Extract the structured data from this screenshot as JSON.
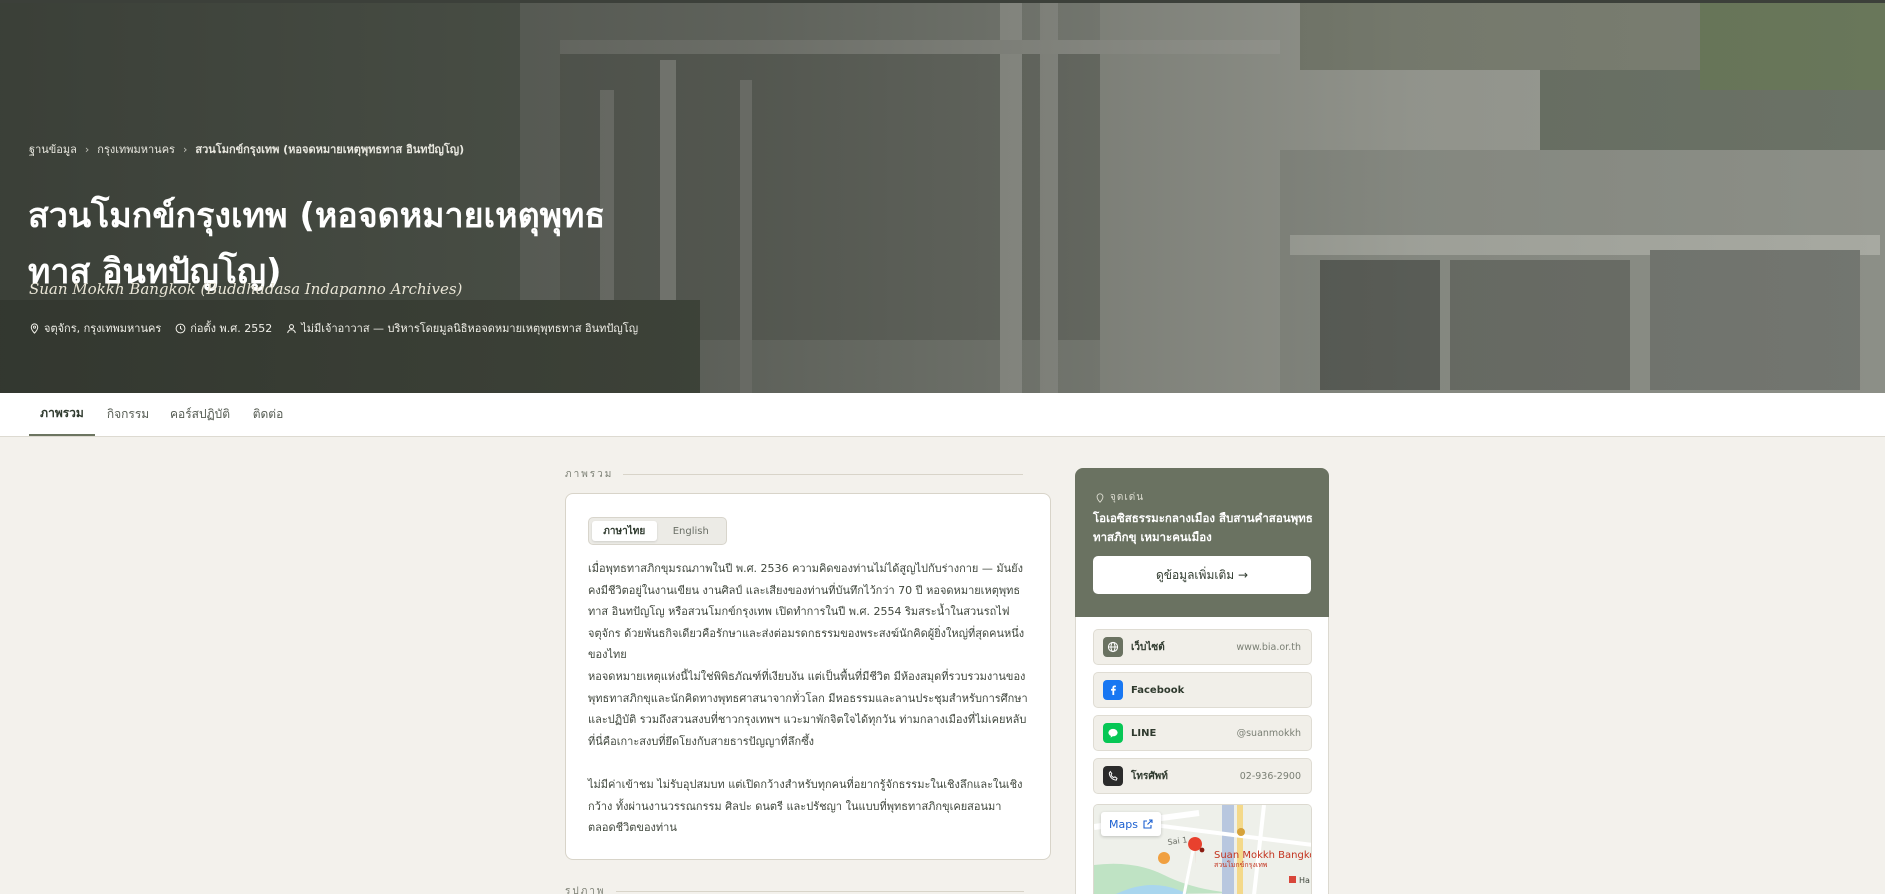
{
  "hero": {
    "breadcrumb": [
      "ฐานข้อมูล",
      "กรุงเทพมหานคร",
      "สวนโมกข์กรุงเทพ (หอจดหมายเหตุพุทธทาส อินทปัญโญ)"
    ],
    "breadcrumb_sep": "›",
    "title_line1": "สวนโมกข์กรุงเทพ (หอจดหมายเหตุพุทธ",
    "title_line2": "ทาส อินทปัญโญ)",
    "subtitle": "Suan Mokkh Bangkok (Buddhadasa Indapanno Archives)",
    "meta": {
      "location": "จตุจักร, กรุงเทพมหานคร",
      "founded": "ก่อตั้ง พ.ศ. 2552",
      "abbot": "ไม่มีเจ้าอาวาส — บริหารโดยมูลนิธิหอจดหมายเหตุพุทธทาส อินทปัญโญ"
    }
  },
  "tabs": [
    "ภาพรวม",
    "กิจกรรม",
    "คอร์สปฏิบัติ",
    "ติดต่อ"
  ],
  "overview": {
    "section_label": "ภาพรวม",
    "next_section_label": "รูปภาพ",
    "lang": {
      "thai": "ภาษาไทย",
      "english": "English"
    },
    "paragraphs": [
      "เมื่อพุทธทาสภิกขุมรณภาพในปี พ.ศ. 2536 ความคิดของท่านไม่ได้สูญไปกับร่างกาย — มันยังคงมีชีวิตอยู่ในงานเขียน งานศิลป์ และเสียงของท่านที่บันทึกไว้กว่า 70 ปี หอจดหมายเหตุพุทธทาส อินทปัญโญ หรือสวนโมกข์กรุงเทพ เปิดทำการในปี พ.ศ. 2554 ริมสระน้ำในสวนรถไฟ จตุจักร ด้วยพันธกิจเดียวคือรักษาและส่งต่อมรดกธรรมของพระสงฆ์นักคิดผู้ยิ่งใหญ่ที่สุดคนหนึ่งของไทย",
      "หอจดหมายเหตุแห่งนี้ไม่ใช่พิพิธภัณฑ์ที่เงียบงัน แต่เป็นพื้นที่มีชีวิต มีห้องสมุดที่รวบรวมงานของพุทธทาสภิกขุและนักคิดทางพุทธศาสนาจากทั่วโลก มีหอธรรมและลานประชุมสำหรับการศึกษาและปฏิบัติ รวมถึงสวนสงบที่ชาวกรุงเทพฯ แวะมาพักจิตใจได้ทุกวัน ท่ามกลางเมืองที่ไม่เคยหลับ ที่นี่คือเกาะสงบที่ยึดโยงกับสายธารปัญญาที่ลึกซึ้ง",
      "ไม่มีค่าเข้าชม ไม่รับอุปสมบท แต่เปิดกว้างสำหรับทุกคนที่อยากรู้จักธรรมะในเชิงลึกและในเชิงกว้าง ทั้งผ่านงานวรรณกรรม ศิลปะ ดนตรี และปรัชญา ในแบบที่พุทธทาสภิกขุเคยสอนมาตลอดชีวิตของท่าน"
    ]
  },
  "sidebar": {
    "highlight_label": "จุดเด่น",
    "highlight_text": "โอเอซิสธรรมะกลางเมือง สืบสานคำสอนพุทธทาสภิกขุ เหมาะคนเมือง",
    "cta": "ดูข้อมูลเพิ่มเติม →",
    "contacts": [
      {
        "label": "เว็บไซต์",
        "value": "www.bia.or.th"
      },
      {
        "label": "Facebook",
        "value": ""
      },
      {
        "label": "LINE",
        "value": "@suanmokkh"
      },
      {
        "label": "โทรศัพท์",
        "value": "02-936-2900"
      }
    ],
    "map": {
      "button": "Maps",
      "place_en": "Suan Mokkh Bangkok",
      "place_th": "สวนโมกข์กรุงเทพ",
      "road": "Sai 1",
      "poi": "Ha"
    }
  },
  "colors": {
    "accent": "#6a7261",
    "facebook": "#1877f2",
    "line": "#06c755",
    "phone": "#2b2b2b",
    "web": "#6a7261"
  }
}
